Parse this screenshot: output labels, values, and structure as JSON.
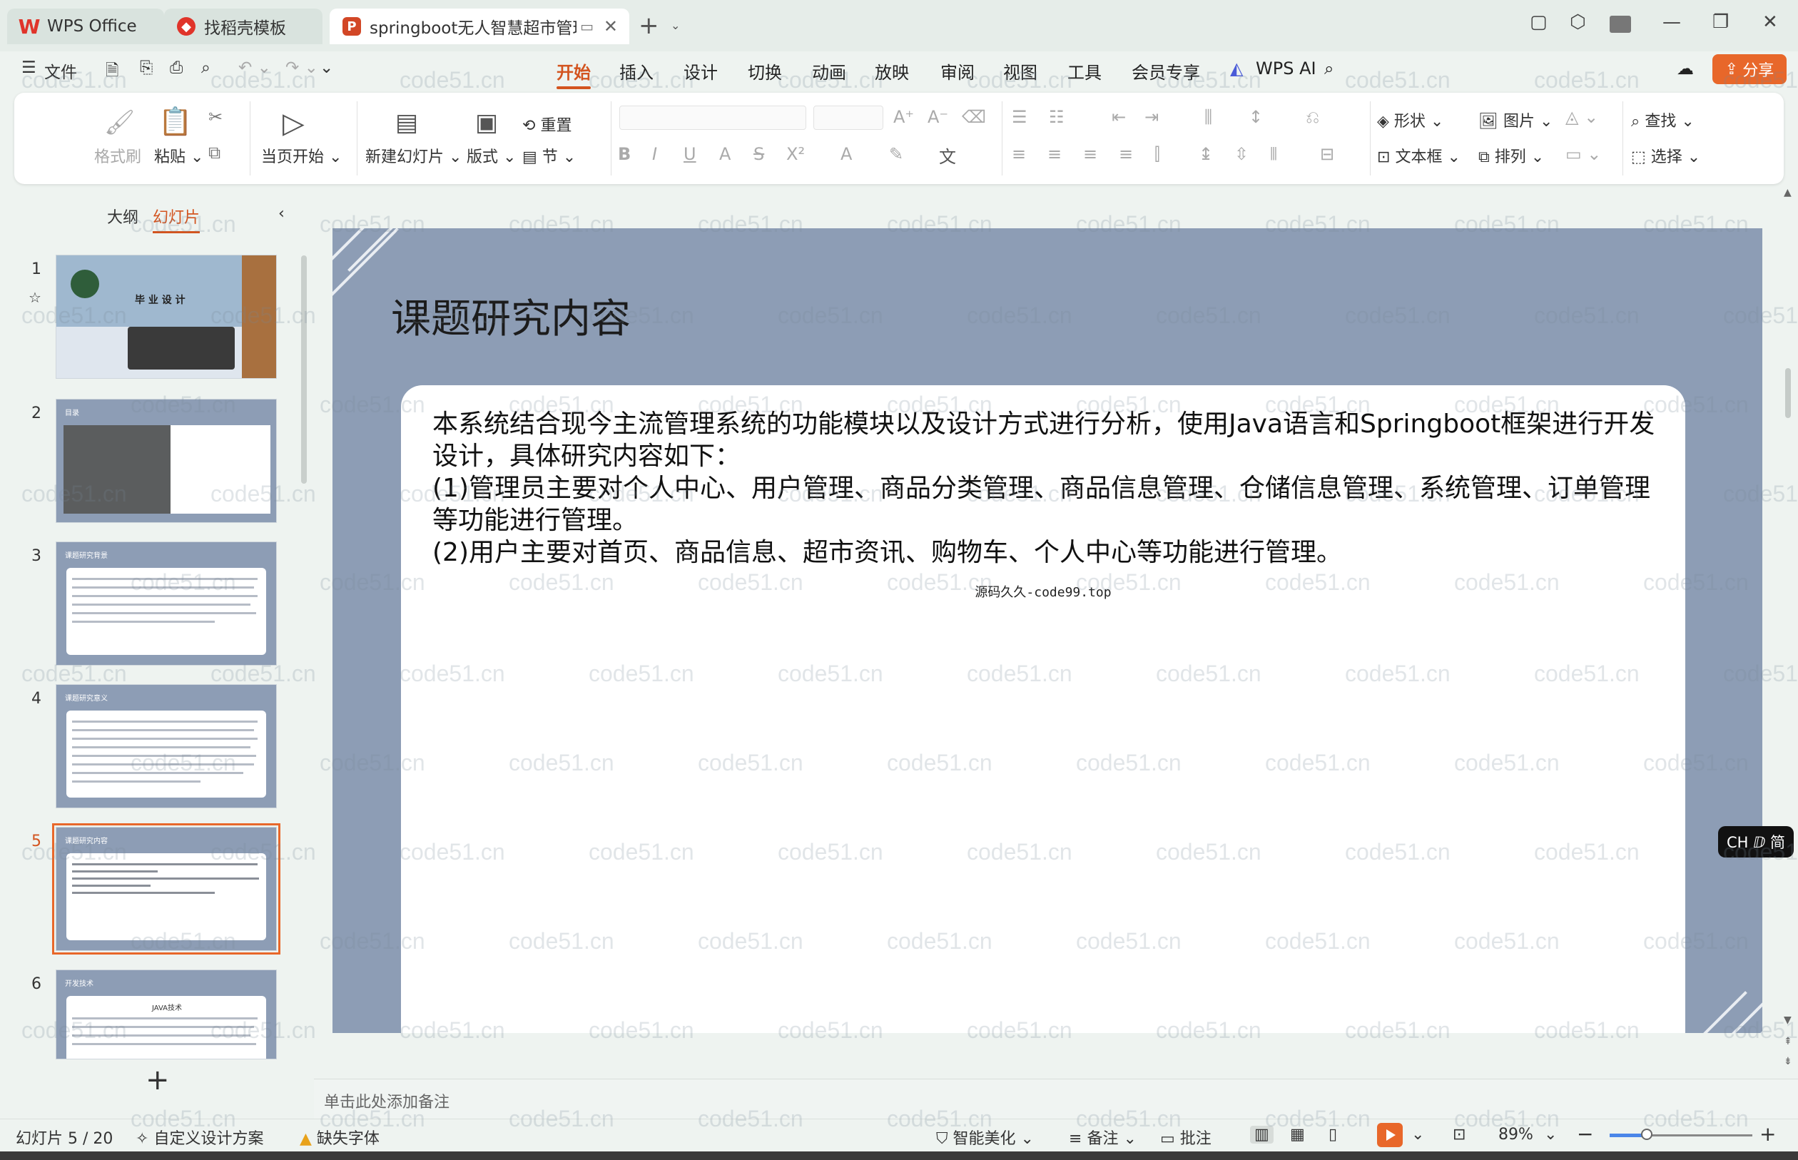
{
  "titlebar": {
    "tabs": [
      {
        "label": "WPS Office",
        "icon": "wps-logo-icon"
      },
      {
        "label": "找稻壳模板",
        "icon": "docer-icon"
      },
      {
        "label": "springboot无人智慧超市管理",
        "icon": "ppt-file-icon"
      }
    ]
  },
  "menu": {
    "file": "文件",
    "tabs": [
      "开始",
      "插入",
      "设计",
      "切换",
      "动画",
      "放映",
      "审阅",
      "视图",
      "工具",
      "会员专享"
    ],
    "active_tab": "开始",
    "wps_ai": "WPS AI",
    "share": "分享"
  },
  "ribbon": {
    "format_painter": "格式刷",
    "paste": "粘贴",
    "play_from_current": "当页开始",
    "new_slide": "新建幻灯片",
    "layout": "版式",
    "reset": "重置",
    "section": "节",
    "shape": "形状",
    "picture": "图片",
    "textbox": "文本框",
    "arrange": "排列",
    "find": "查找",
    "select": "选择"
  },
  "pane": {
    "tab_outline": "大纲",
    "tab_slides": "幻灯片",
    "slides": [
      {
        "num": "1",
        "title": "毕 业 设 计"
      },
      {
        "num": "2",
        "title": "目录"
      },
      {
        "num": "3",
        "title": "课题研究背景"
      },
      {
        "num": "4",
        "title": "课题研究意义"
      },
      {
        "num": "5",
        "title": "课题研究内容"
      },
      {
        "num": "6",
        "title": "开发技术"
      }
    ],
    "slide6_sub": "JAVA技术"
  },
  "slide": {
    "title": "课题研究内容",
    "paragraphs": [
      "本系统结合现今主流管理系统的功能模块以及设计方式进行分析，使用Java语言和Springboot框架进行开发设计，具体研究内容如下：",
      "(1)管理员主要对个人中心、用户管理、商品分类管理、商品信息管理、仓储信息管理、系统管理、订单管理等功能进行管理。",
      "(2)用户主要对首页、商品信息、超市资讯、购物车、个人中心等功能进行管理。"
    ],
    "source_note": "源码久久-code99.top"
  },
  "ime": "CH ⅅ 简",
  "notes": {
    "placeholder": "单击此处添加备注"
  },
  "status": {
    "slide_counter": "幻灯片 5 / 20",
    "design_scheme": "自定义设计方案",
    "missing_font": "缺失字体",
    "smart_beautify": "智能美化",
    "notes": "备注",
    "comments": "批注",
    "zoom": "89%",
    "zoom_level": 0.26
  },
  "watermark": "code51.cn",
  "colors": {
    "accent": "#d3541f",
    "slide_bg": "#8d9db5",
    "share": "#e8672a"
  }
}
